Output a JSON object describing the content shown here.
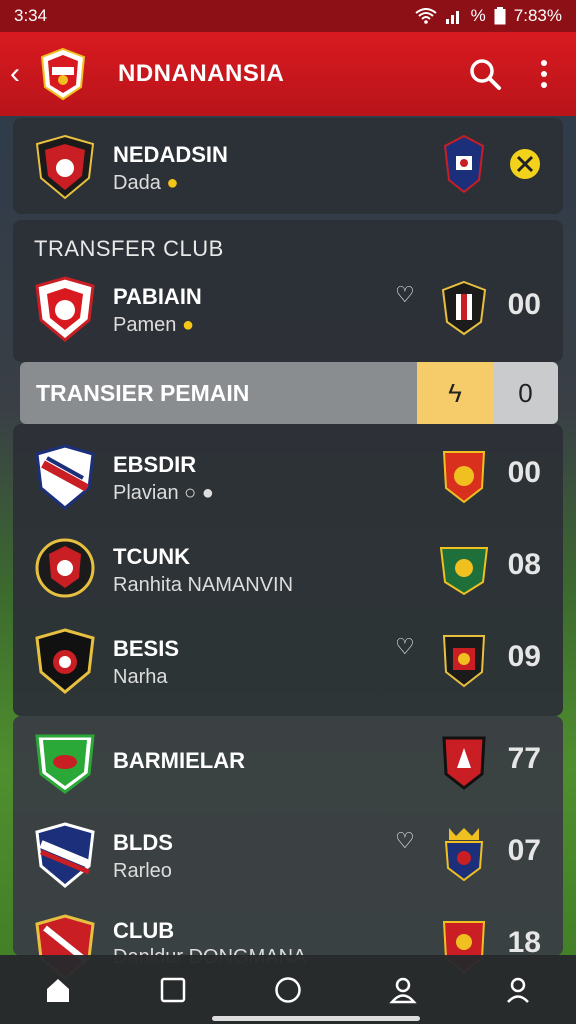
{
  "status": {
    "time_left": "3:34",
    "battery": "%",
    "time_right": "7:83%"
  },
  "header": {
    "title": "NDNANANSIA"
  },
  "top_card": {
    "name": "NEDADSIN",
    "sub": "Dada",
    "coin": "●"
  },
  "transfer_club": {
    "title": "TRANSFER CLUB",
    "row": {
      "name": "PABIAIN",
      "sub": "Pamen",
      "score": "00"
    }
  },
  "transfer_bar": {
    "label": "TRANSIER PEMAIN",
    "bolt": "ϟ",
    "count": "0"
  },
  "rows": [
    {
      "name": "EBSDIR",
      "sub": "Plavian ○ ●",
      "score": "00",
      "heart": false
    },
    {
      "name": "TCUNK",
      "sub": "Ranhita NAMANVIN",
      "score": "08",
      "heart": false
    },
    {
      "name": "BESIS",
      "sub": "Narha",
      "score": "09",
      "heart": true
    },
    {
      "name": "BARMIELAR",
      "sub": "",
      "score": "77",
      "heart": false
    },
    {
      "name": "BLDS",
      "sub": "Rarleo",
      "score": "07",
      "heart": true
    },
    {
      "name": "CLUB",
      "sub": "Danldur DONGMANA",
      "score": "18",
      "heart": false
    }
  ],
  "colors": {
    "primary": "#d81a20",
    "card": "#2c3037",
    "accent": "#f5c518"
  },
  "icons": [
    "back-icon",
    "search-icon",
    "more-vert-icon",
    "home-icon",
    "square-icon",
    "circle-icon",
    "person-icon",
    "user-icon"
  ]
}
